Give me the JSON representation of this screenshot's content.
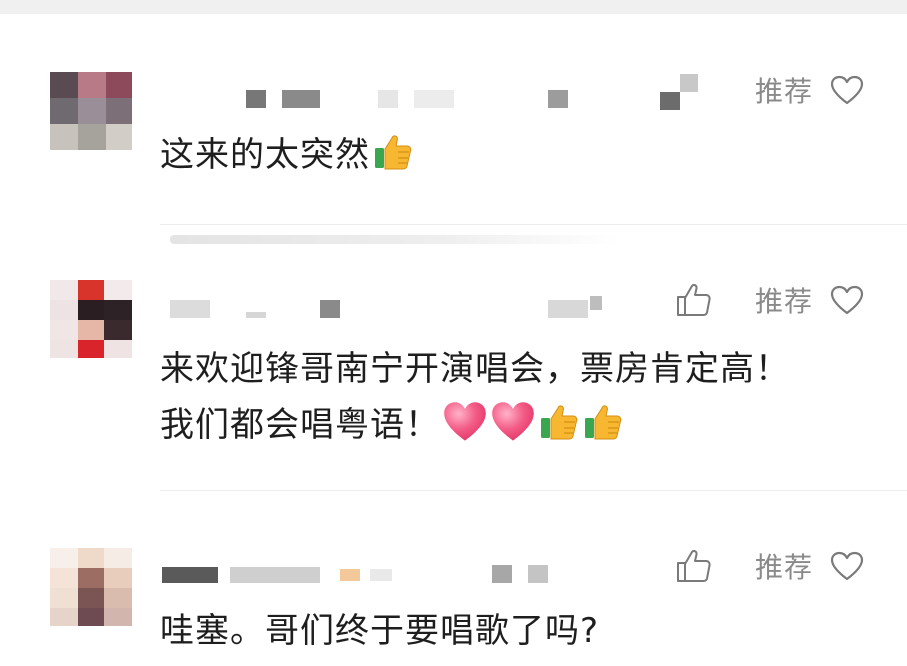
{
  "comments": [
    {
      "text": "这来的太突然",
      "emojis": [
        "thumbs-up"
      ],
      "recommend_label": "推荐",
      "has_like": false
    },
    {
      "text_line1": "来欢迎锋哥南宁开演唱会，票房肯定高！",
      "text_line2": "我们都会唱粤语！",
      "emojis": [
        "heart",
        "heart",
        "thumbs-up",
        "thumbs-up"
      ],
      "recommend_label": "推荐",
      "has_like": true
    },
    {
      "text": "哇塞。哥们终于要唱歌了吗?",
      "recommend_label": "推荐",
      "has_like": true
    }
  ],
  "icons": {
    "like": "thumbs-up-outline-icon",
    "favorite": "heart-outline-icon",
    "emoji_thumb": "thumbs-up-emoji",
    "emoji_heart": "heart-emoji"
  },
  "colors": {
    "label_gray": "#8a8a8a",
    "heart_pink": "#f0487a",
    "thumb_yellow": "#f7b731",
    "thumb_green": "#3aa64f"
  }
}
